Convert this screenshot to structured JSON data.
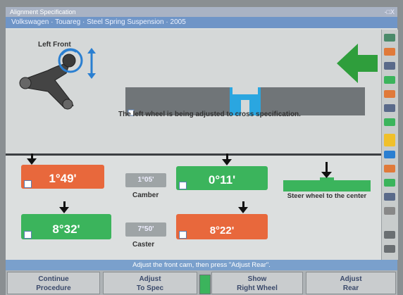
{
  "window": {
    "title": "Alignment Specification",
    "controls": "-□X"
  },
  "breadcrumb": "Volkswagen · Touareg · Steel Spring Suspension · 2005",
  "upper": {
    "corner_label": "Left Front",
    "message": "The left wheel is being adjusted to cross specification."
  },
  "readings": {
    "camber_left": "1°49'",
    "camber_spec": "1°05'",
    "camber_right": "0°11'",
    "camber_label": "Camber",
    "caster_left": "8°32'",
    "caster_spec": "7°50'",
    "caster_right": "8°22'",
    "caster_label": "Caster",
    "steer_msg": "Steer wheel to the center"
  },
  "status_text": "Adjust the front cam, then press \"Adjust Rear\".",
  "buttons": [
    {
      "line1": "Continue",
      "line2": "Procedure"
    },
    {
      "line1": "Adjust",
      "line2": "To Spec"
    },
    {
      "line1": "Show",
      "line2": "Right Wheel"
    },
    {
      "line1": "Adjust",
      "line2": "Rear"
    }
  ],
  "colors": {
    "out_of_spec": "#e8683c",
    "in_spec": "#3bb45c",
    "accent_blue": "#2aa6e0"
  }
}
